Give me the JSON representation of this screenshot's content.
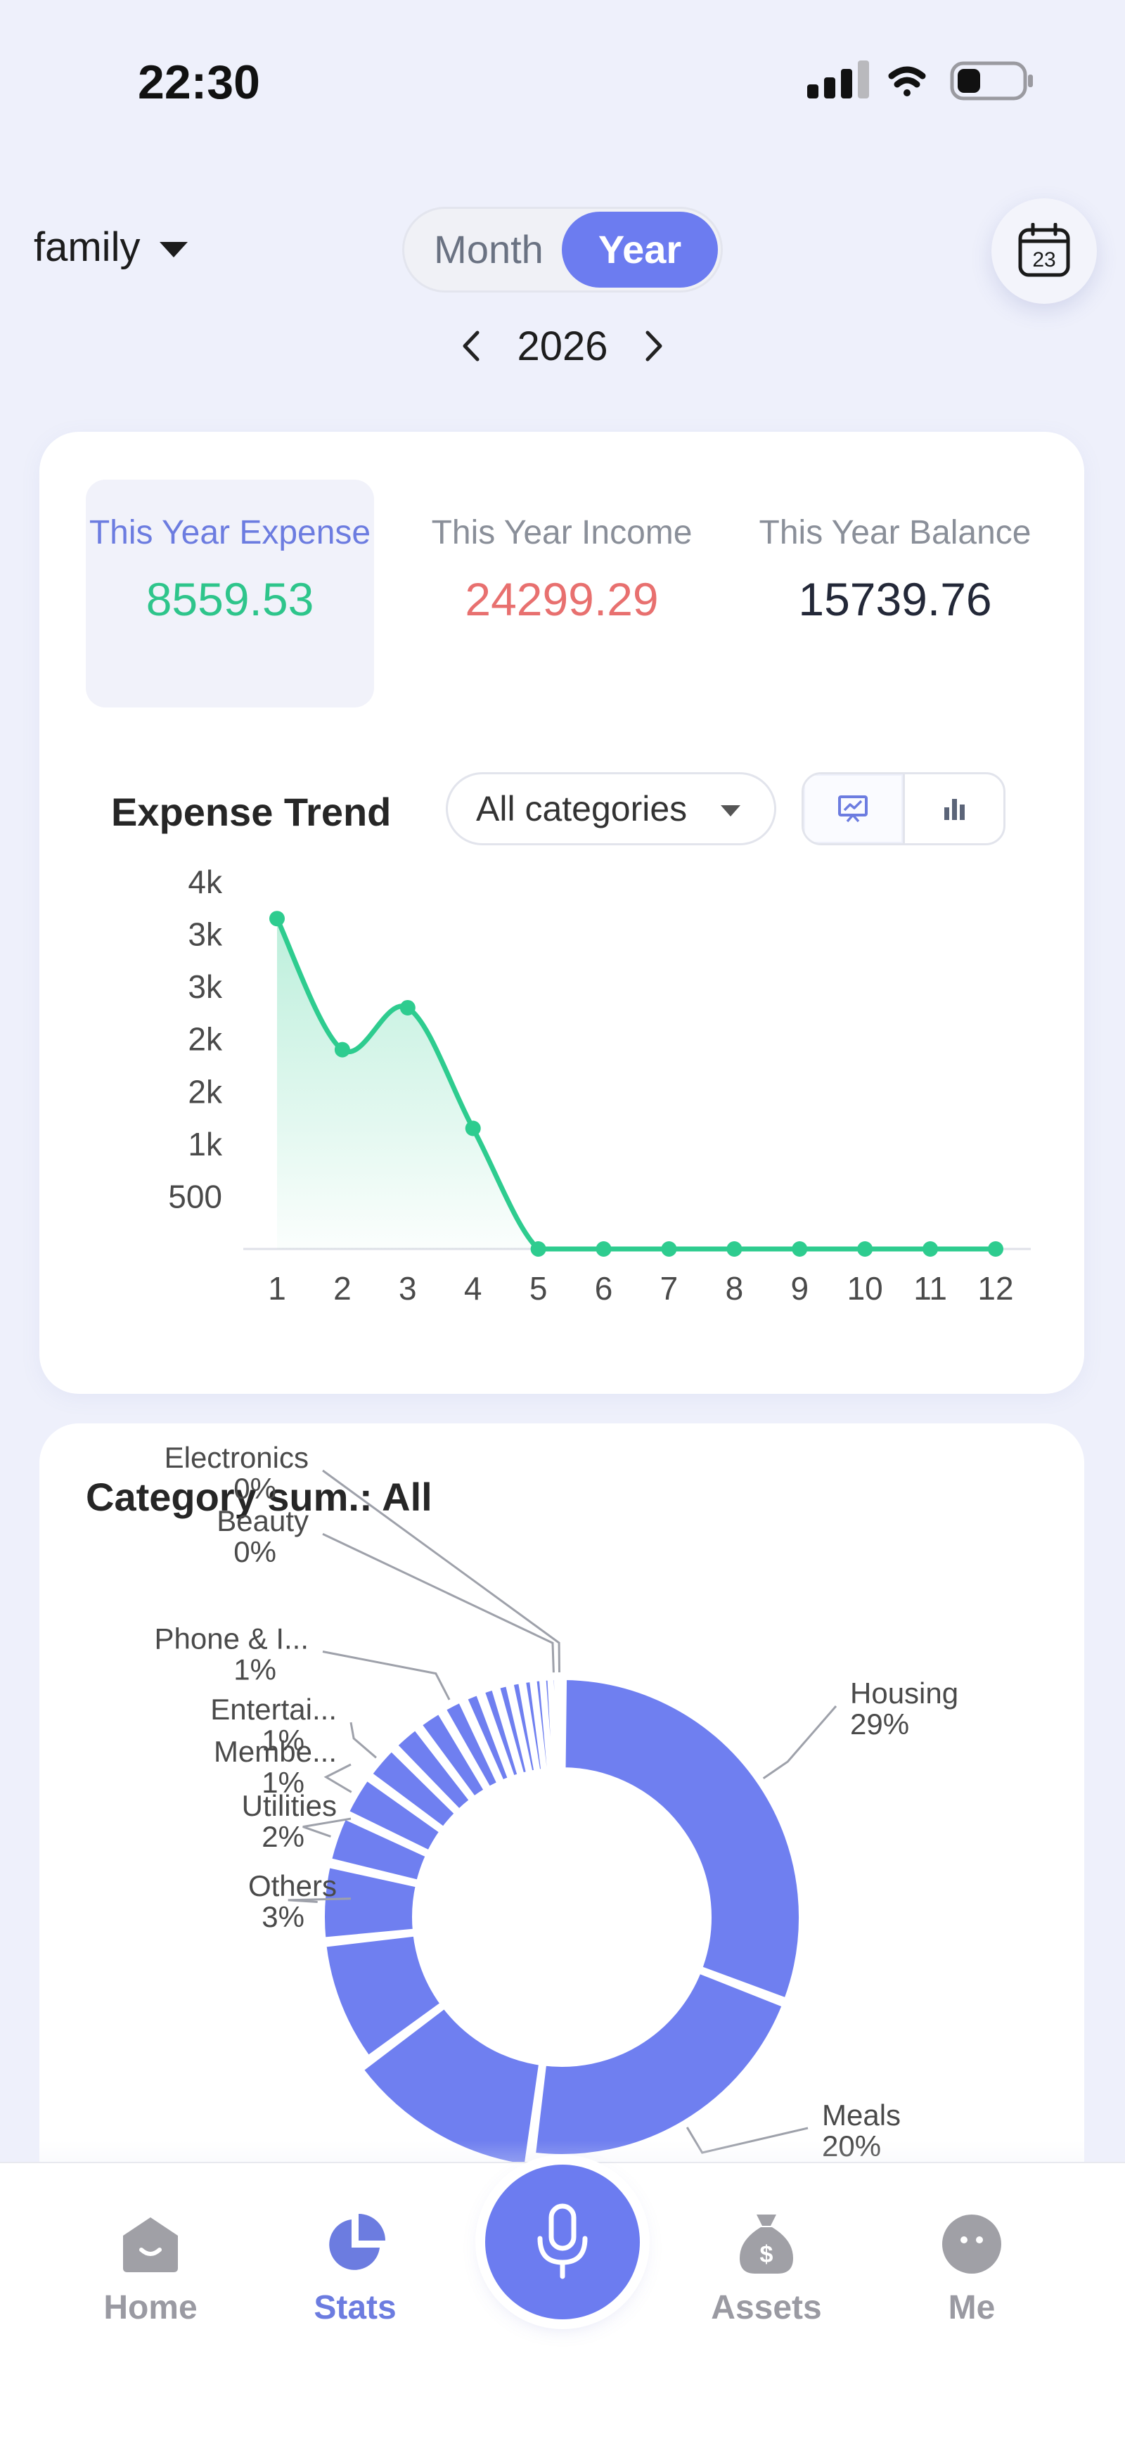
{
  "status_bar": {
    "time": "22:30"
  },
  "header": {
    "ledger_name": "family",
    "segment": {
      "month_label": "Month",
      "year_label": "Year",
      "selected": "Year"
    },
    "calendar_day": "23",
    "year": "2026"
  },
  "summary": {
    "expense": {
      "label": "This Year Expense",
      "value": "8559.53"
    },
    "income": {
      "label": "This Year Income",
      "value": "24299.29"
    },
    "balance": {
      "label": "This Year Balance",
      "value": "15739.76"
    }
  },
  "trend": {
    "title": "Expense Trend",
    "category_filter": "All categories",
    "chart_modes": [
      "line",
      "bar"
    ],
    "selected_mode": "line"
  },
  "chart_data": [
    {
      "type": "area",
      "title": "Expense Trend",
      "x": [
        1,
        2,
        3,
        4,
        5,
        6,
        7,
        8,
        9,
        10,
        11,
        12
      ],
      "series": [
        {
          "values": [
            3150,
            1900,
            2300,
            1150,
            0,
            0,
            0,
            0,
            0,
            0,
            0,
            0
          ]
        }
      ],
      "y_tick_labels": [
        "500",
        "1k",
        "2k",
        "2k",
        "3k",
        "3k",
        "4k"
      ],
      "ylim": [
        0,
        3500
      ],
      "color": "#2ecc8f",
      "grid": false
    },
    {
      "type": "pie",
      "title": "Category sum.: All",
      "donut": true,
      "slices": [
        {
          "label": "Housing",
          "pct_label": "29%",
          "value": 29
        },
        {
          "label": "Meals",
          "pct_label": "20%",
          "value": 20
        },
        {
          "label": "",
          "pct_label": "",
          "value": 12
        },
        {
          "label": "",
          "pct_label": "",
          "value": 8
        },
        {
          "label": "Others",
          "pct_label": "3%",
          "value": 5
        },
        {
          "label": "Utilities",
          "pct_label": "2%",
          "value": 3.2
        },
        {
          "label": "Membe...",
          "pct_label": "1%",
          "value": 2.8
        },
        {
          "label": "Entertai...",
          "pct_label": "1%",
          "value": 2.4
        },
        {
          "label": "",
          "pct_label": "",
          "value": 2
        },
        {
          "label": "",
          "pct_label": "",
          "value": 1.8
        },
        {
          "label": "Phone & I...",
          "pct_label": "1%",
          "value": 1.5
        },
        {
          "label": "",
          "pct_label": "",
          "value": 1.2
        },
        {
          "label": "",
          "pct_label": "",
          "value": 1
        },
        {
          "label": "",
          "pct_label": "",
          "value": 0.9
        },
        {
          "label": "",
          "pct_label": "",
          "value": 0.8
        },
        {
          "label": "",
          "pct_label": "",
          "value": 0.7
        },
        {
          "label": "",
          "pct_label": "",
          "value": 0.6
        },
        {
          "label": "",
          "pct_label": "",
          "value": 0.5
        },
        {
          "label": "Beauty",
          "pct_label": "0%",
          "value": 0.4
        },
        {
          "label": "Electronics",
          "pct_label": "0%",
          "value": 0.3
        }
      ],
      "color": "#6f7ff0"
    }
  ],
  "category_section": {
    "title": "Category sum.: All"
  },
  "tabbar": {
    "home": "Home",
    "stats": "Stats",
    "assets": "Assets",
    "me": "Me",
    "selected": "Stats"
  },
  "colors": {
    "accent": "#6c7cf0",
    "expense": "#2ec58b",
    "income": "#e8706f",
    "background": "#eef0fb"
  }
}
